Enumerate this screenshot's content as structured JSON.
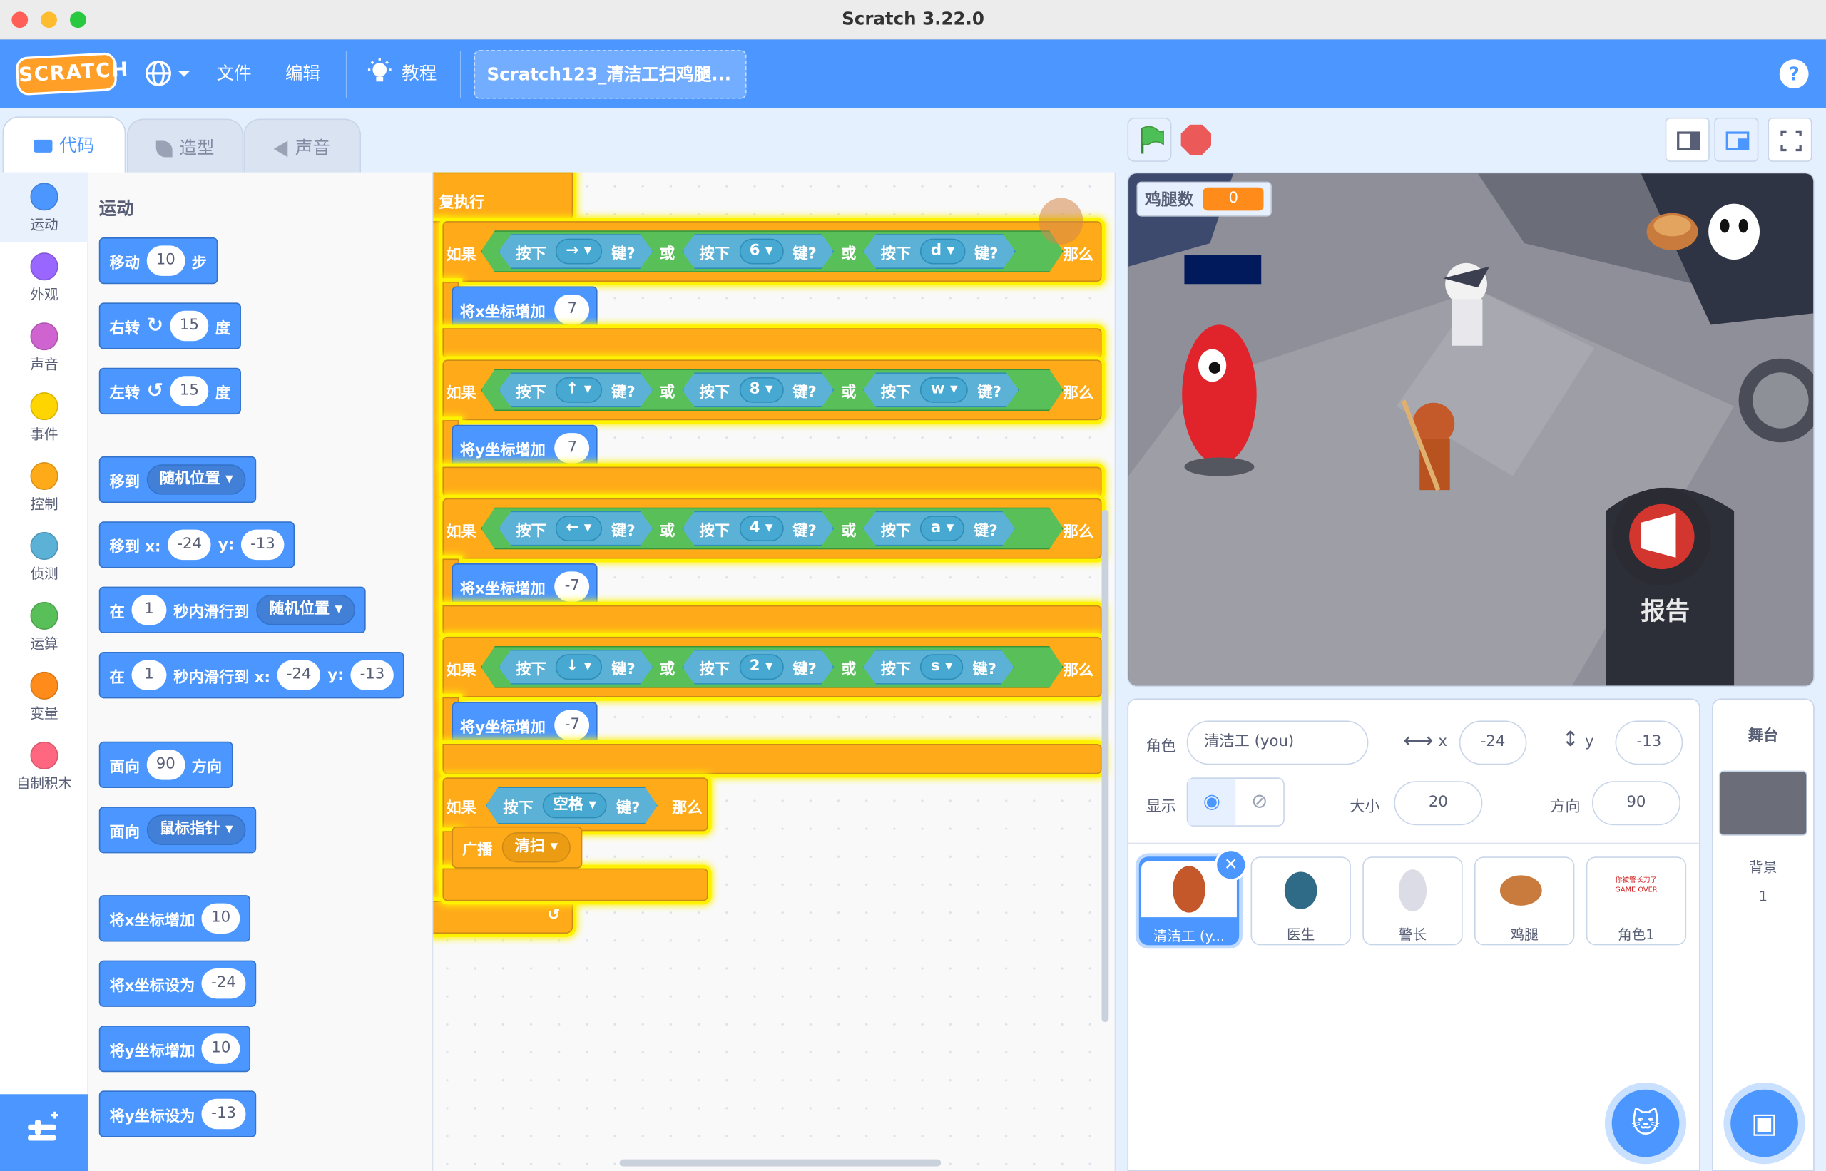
{
  "window": {
    "title": "Scratch 3.22.0"
  },
  "menubar": {
    "logo": "SCRATCH",
    "file": "文件",
    "edit": "编辑",
    "tutorials": "教程",
    "project_title": "Scratch123_清洁工扫鸡腿...",
    "help": "?"
  },
  "tabs": [
    {
      "label": "代码",
      "active": true
    },
    {
      "label": "造型",
      "active": false
    },
    {
      "label": "声音",
      "active": false
    }
  ],
  "categories": [
    {
      "label": "运动",
      "color": "#4c97ff"
    },
    {
      "label": "外观",
      "color": "#9966ff"
    },
    {
      "label": "声音",
      "color": "#cf63cf"
    },
    {
      "label": "事件",
      "color": "#ffd500"
    },
    {
      "label": "控制",
      "color": "#ffab19"
    },
    {
      "label": "侦测",
      "color": "#5cb1d6"
    },
    {
      "label": "运算",
      "color": "#59c059"
    },
    {
      "label": "变量",
      "color": "#ff8c1a"
    },
    {
      "label": "自制积木",
      "color": "#ff6680"
    }
  ],
  "palette": {
    "heading": "运动",
    "move": {
      "label": "移动",
      "value": "10",
      "suffix": "步"
    },
    "turn_right": {
      "label": "右转",
      "value": "15",
      "suffix": "度"
    },
    "turn_left": {
      "label": "左转",
      "value": "15",
      "suffix": "度"
    },
    "goto": {
      "label": "移到",
      "option": "随机位置"
    },
    "goto_xy": {
      "label": "移到 x:",
      "x": "-24",
      "ylabel": "y:",
      "y": "-13"
    },
    "glide": {
      "label": "在",
      "secs": "1",
      "mid": "秒内滑行到",
      "option": "随机位置"
    },
    "glide_xy": {
      "label": "在",
      "secs": "1",
      "mid": "秒内滑行到 x:",
      "x": "-24",
      "ylabel": "y:",
      "y": "-13"
    },
    "point_dir": {
      "label": "面向",
      "value": "90",
      "suffix": "方向"
    },
    "point_towards": {
      "label": "面向",
      "option": "鼠标指针"
    },
    "change_x": {
      "label": "将x坐标增加",
      "value": "10"
    },
    "set_x": {
      "label": "将x坐标设为",
      "value": "-24"
    },
    "change_y": {
      "label": "将y坐标增加",
      "value": "10"
    },
    "set_y": {
      "label": "将y坐标设为",
      "value": "-13"
    }
  },
  "script": {
    "forever": "复执行",
    "if_word": "如果",
    "or_word": "或",
    "then_word": "那么",
    "key_pressed": "按下",
    "key_suffix": "键?",
    "rows": [
      {
        "keys": [
          "→",
          "6",
          "d"
        ],
        "action": "将x坐标增加",
        "value": "7"
      },
      {
        "keys": [
          "↑",
          "8",
          "w"
        ],
        "action": "将y坐标增加",
        "value": "7"
      },
      {
        "keys": [
          "←",
          "4",
          "a"
        ],
        "action": "将x坐标增加",
        "value": "-7"
      },
      {
        "keys": [
          "↓",
          "2",
          "s"
        ],
        "action": "将y坐标增加",
        "value": "-7"
      }
    ],
    "space_if": {
      "key": "空格"
    },
    "broadcast": {
      "label": "广播",
      "message": "清扫"
    },
    "zoom_in": "+",
    "zoom_out": "−",
    "zoom_reset": "="
  },
  "stage": {
    "monitor_label": "鸡腿数",
    "monitor_value": "0",
    "report_text": "报告"
  },
  "sprite_info": {
    "sprite_label": "角色",
    "sprite_name": "清洁工 (you)",
    "x_label": "x",
    "x": "-24",
    "y_label": "y",
    "y": "-13",
    "show_label": "显示",
    "size_label": "大小",
    "size": "20",
    "direction_label": "方向",
    "direction": "90"
  },
  "sprites": [
    {
      "name": "清洁工 (y...",
      "selected": true
    },
    {
      "name": "医生",
      "selected": false
    },
    {
      "name": "警长",
      "selected": false
    },
    {
      "name": "鸡腿",
      "selected": false
    },
    {
      "name": "角色1",
      "selected": false
    }
  ],
  "sprite5_thumb_text": "你被警长刀了\nGAME OVER",
  "stage_selector": {
    "title": "舞台",
    "backdrops_label": "背景",
    "backdrops_count": "1"
  }
}
